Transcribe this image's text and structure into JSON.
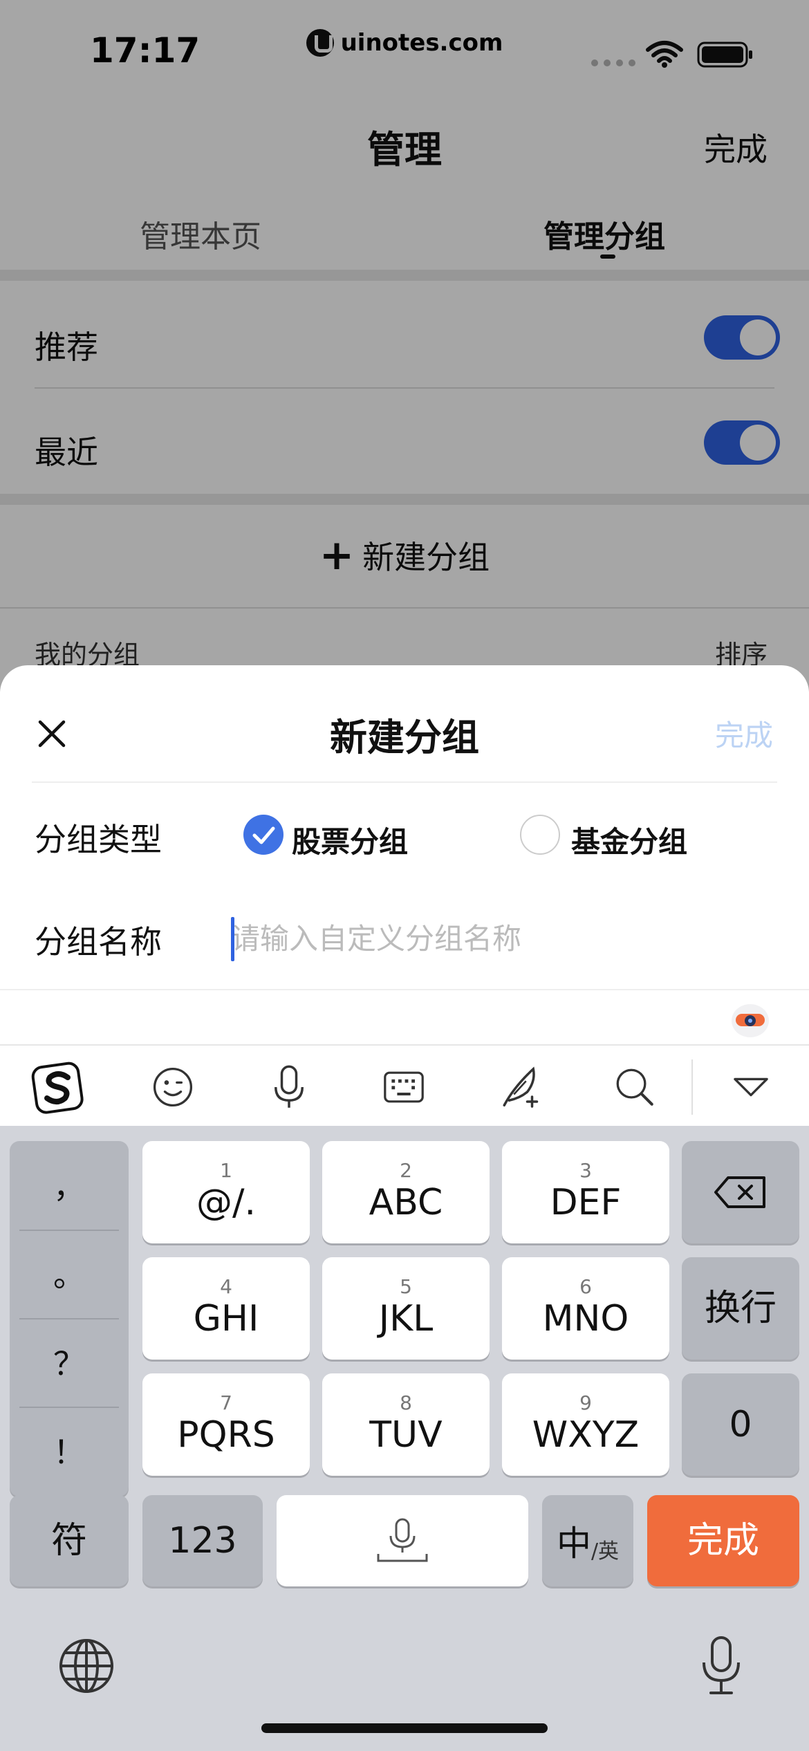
{
  "status_bar": {
    "time": "17:17",
    "url": "uinotes.com"
  },
  "nav": {
    "title": "管理",
    "done_label": "完成"
  },
  "tabs": [
    {
      "label": "管理本页",
      "active": false
    },
    {
      "label": "管理分组",
      "active": true
    }
  ],
  "settings": [
    {
      "label": "推荐",
      "enabled": true
    },
    {
      "label": "最近",
      "enabled": true
    }
  ],
  "new_group_button": "新建分组",
  "group_list": {
    "title": "我的分组",
    "sort_label": "排序"
  },
  "sheet": {
    "title": "新建分组",
    "done_label": "完成",
    "type_label": "分组类型",
    "type_options": [
      {
        "label": "股票分组",
        "checked": true
      },
      {
        "label": "基金分组",
        "checked": false
      }
    ],
    "name_label": "分组名称",
    "name_placeholder": "请输入自定义分组名称",
    "name_value": ""
  },
  "keyboard": {
    "toolbar": [
      "sogou-logo-icon",
      "emoji-icon",
      "voice-icon",
      "keyboard-icon",
      "handwriting-icon",
      "search-icon",
      "collapse-icon"
    ],
    "punctuation": [
      "，",
      "。",
      "？",
      "！"
    ],
    "keys": [
      {
        "num": "1",
        "label": "@/."
      },
      {
        "num": "2",
        "label": "ABC"
      },
      {
        "num": "3",
        "label": "DEF"
      },
      {
        "num": "4",
        "label": "GHI"
      },
      {
        "num": "5",
        "label": "JKL"
      },
      {
        "num": "6",
        "label": "MNO"
      },
      {
        "num": "7",
        "label": "PQRS"
      },
      {
        "num": "8",
        "label": "TUV"
      },
      {
        "num": "9",
        "label": "WXYZ"
      }
    ],
    "newline_label": "换行",
    "zero_label": "0",
    "symbol_label": "符",
    "numeric_label": "123",
    "lang_main": "中",
    "lang_sub": "/英",
    "done_label": "完成"
  },
  "colors": {
    "accent": "#2f62e0",
    "done_orange": "#f06c3c",
    "keyboard_bg": "#d2d4da"
  }
}
